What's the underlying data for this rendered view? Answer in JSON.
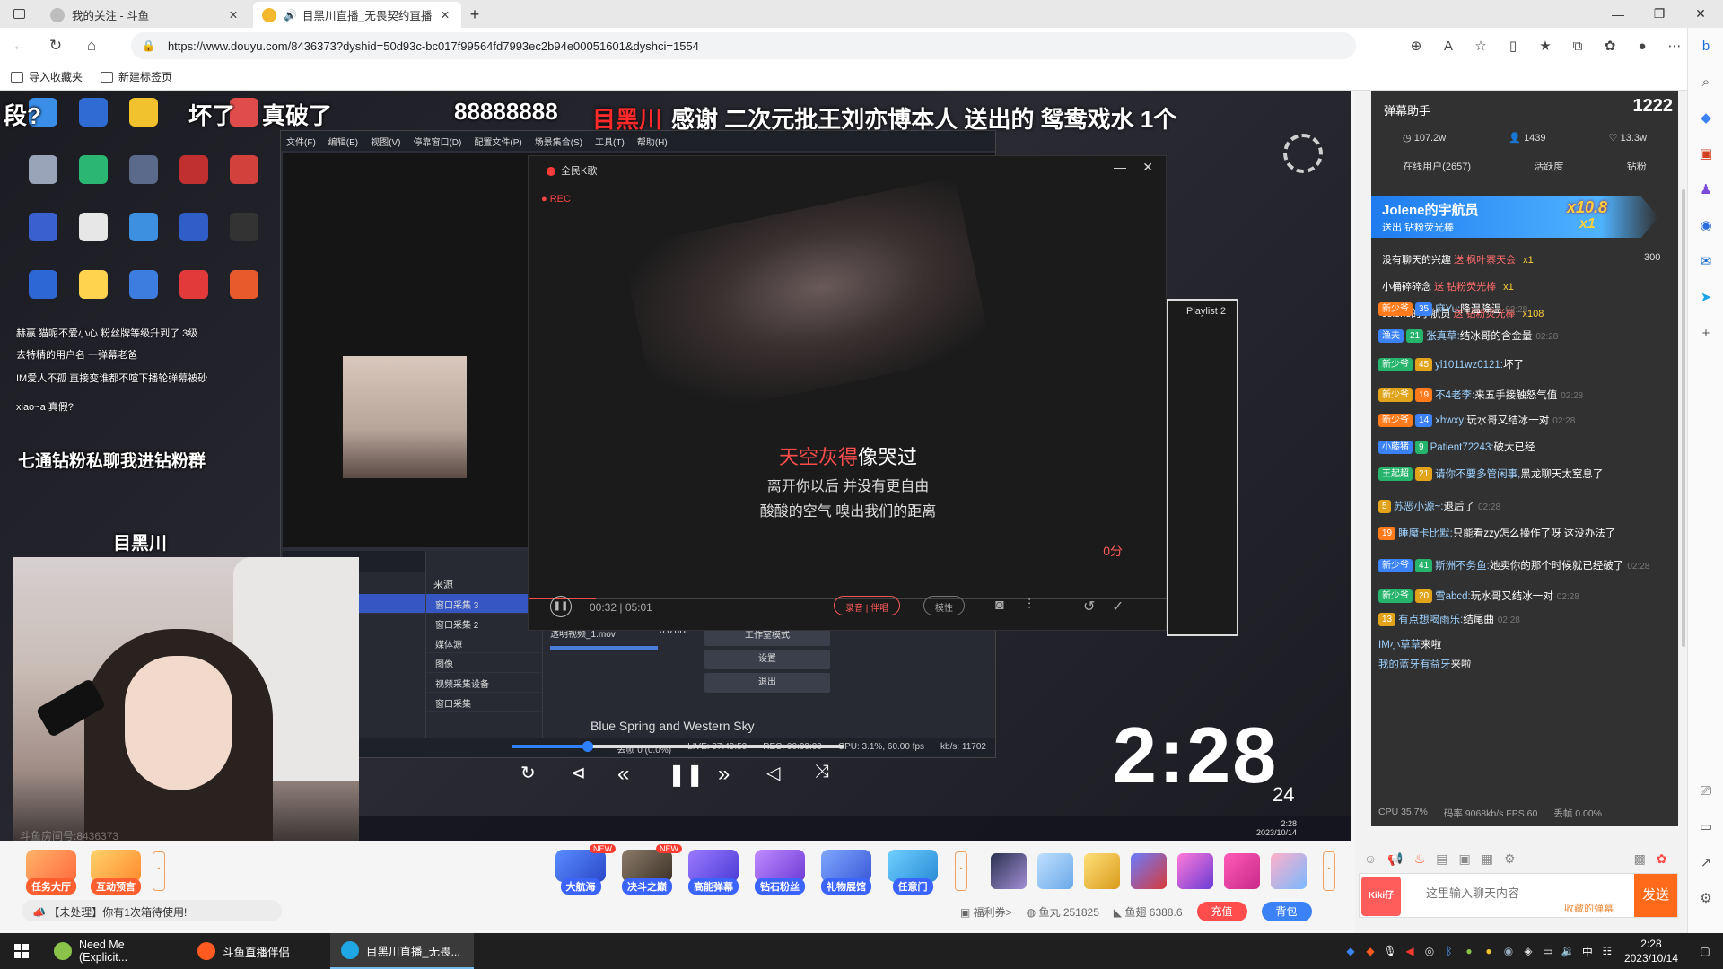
{
  "browser": {
    "tabs": [
      {
        "label": "我的关注 - 斗鱼",
        "active": false
      },
      {
        "label": "目黑川直播_无畏契约直播",
        "active": true
      }
    ],
    "url": "https://www.douyu.com/8436373?dyshid=50d93c-bc017f99564fd7993ec2b94e00051601&dyshci=1554",
    "favorites": [
      "导入收藏夹",
      "新建标签页"
    ]
  },
  "stream": {
    "danmu_top": [
      "段?",
      "坏了",
      "真破了",
      "88888888"
    ],
    "gift_banner": {
      "name": "目黑川",
      "text": "感谢 二次元批王刘亦博本人 送出的 鸳鸯戏水 1个"
    },
    "overlay_big": [
      "七通钻粉私聊我进钻粉群",
      "目黑川"
    ],
    "overlay_lines": [
      "赫赢 猫呢不爱小心 粉丝牌等级升到了 3级",
      "去特精的用户名 一弹幕老爸",
      "IM爱人不孤 直接变谁都不喧下播轮弹幕被砂",
      "xiao~a 真假?"
    ],
    "cam_watermark": "斗鱼房间号:8436373",
    "obs": {
      "menu": [
        "文件(F)",
        "编辑(E)",
        "视图(V)",
        "停靠窗口(D)",
        "配置文件(P)",
        "场景集合(S)",
        "工具(T)",
        "帮助(H)"
      ],
      "window_title": "窗口采集 3",
      "scene_header": "场景",
      "source_header": "来源",
      "sources": [
        "窗口采集 3",
        "窗口采集 2",
        "媒体源",
        "图像",
        "视频采集设备",
        "窗口采集"
      ],
      "audio_track": "透明视频_1.mov",
      "audio_level": "0.0 dB",
      "buttons": [
        "工作室模式",
        "设置",
        "退出"
      ],
      "status": [
        "丢帧 0 (0.0%)",
        "LIVE: 07:49:50",
        "REC: 00:00:00",
        "CPU: 3.1%, 60.00 fps",
        "kb/s: 11702"
      ]
    },
    "player": {
      "title": "全民K歌",
      "rec": "REC",
      "lyric_1_hl": "天空灰得",
      "lyric_1_rest": "像哭过",
      "lyric_2": "离开你以后 并没有更自由",
      "lyric_3": "酸酸的空气 嗅出我们的距离",
      "time": "00:32 | 05:01",
      "score": "0分",
      "progress": 0.105,
      "buttons": [
        "录音 | 伴唱",
        "模性"
      ]
    },
    "playlist_label": "Playlist 2",
    "now_playing": "Blue Spring and Western Sky",
    "now_playing_progress": 0.23,
    "clock": "2:28",
    "clock_seconds": "24",
    "video_taskbar_time": "2:28",
    "video_taskbar_date": "2023/10/14"
  },
  "chat": {
    "header": "弹幕助手",
    "viewer_count": "1222",
    "stats": [
      "107.2w",
      "1439",
      "13.3w"
    ],
    "tabs": [
      "在线用户(2657)",
      "活跃度",
      "钻粉"
    ],
    "gift_card": {
      "user": "Jolene的宇航员",
      "line": "送出 钻粉荧光棒",
      "combo": "x10.8",
      "count": "x1"
    },
    "gift_lines": [
      {
        "user": "没有聊天的兴趣",
        "gift": "送 枫叶寨天会",
        "qty": "x1",
        "right": "300"
      },
      {
        "user": "小桶碎碎念",
        "gift": "送 钻粉荧光棒",
        "qty": "x1",
        "right": ""
      },
      {
        "user": "Jolene的宇航员",
        "gift": "送 钻粉荧光棒",
        "qty": "x108",
        "right": ""
      }
    ],
    "messages": [
      {
        "badges": [
          "新少爷",
          "35"
        ],
        "name": "麻Yu:",
        "text": "降温降温",
        "time": "02:28"
      },
      {
        "badges": [
          "渔夫",
          "21"
        ],
        "name": "张真草:",
        "text": "结冰哥的含金量",
        "time": "02:28"
      },
      {
        "badges": [
          "新少爷",
          "45"
        ],
        "name": "yl1011wz0121:",
        "text": "坏了",
        "time": ""
      },
      {
        "badges": [
          "新少爷",
          "19"
        ],
        "name": "不4老李:",
        "text": "来五手接触怒气值",
        "time": "02:28"
      },
      {
        "badges": [
          "新少爷",
          "14"
        ],
        "name": "xhwxy:",
        "text": "玩水哥又结冰一对",
        "time": "02:28"
      },
      {
        "badges": [
          "小藤猪",
          "9"
        ],
        "name": "Patient72243:",
        "text": "破大已经",
        "time": ""
      },
      {
        "badges": [
          "王起超",
          "21"
        ],
        "name": "请你不要多管闲事,",
        "text": "黑龙聊天太窒息了",
        "time": ""
      },
      {
        "badges": [
          "5"
        ],
        "name": "苏恶小源~:",
        "text": "退后了",
        "time": "02:28"
      },
      {
        "badges": [
          "19"
        ],
        "name": "睡魔卡比默:",
        "text": "只能看zzy怎么操作了呀 这没办法了",
        "time": ""
      },
      {
        "badges": [
          "新少爷",
          "41"
        ],
        "name": "斯洲不务鱼:",
        "text": "她卖你的那个时候就已经破了",
        "time": "02:28"
      },
      {
        "badges": [
          "新少爷",
          "20"
        ],
        "name": "雪abcd:",
        "text": "玩水哥又结冰一对",
        "time": "02:28"
      },
      {
        "badges": [
          "13"
        ],
        "name": "有点想喝雨乐:",
        "text": "结尾曲",
        "time": "02:28"
      },
      {
        "badges": [],
        "name": "IM小草草",
        "text": "来啦",
        "time": ""
      },
      {
        "badges": [],
        "name": "我的蓝牙有益牙",
        "text": "来啦",
        "time": ""
      }
    ],
    "footer": [
      "CPU 35.7%",
      "码率 9068kb/s FPS 60",
      "丢帧 0.00%"
    ],
    "input_placeholder": "这里输入聊天内容",
    "input_hint": "收藏的弹幕",
    "send_label": "发送",
    "avatar_label": "Kiki仔"
  },
  "toolbar": {
    "tools": [
      {
        "label": "任务大厅",
        "color": "#ff5f2e"
      },
      {
        "label": "互动预言",
        "color": "#ff5f2e"
      }
    ],
    "features": [
      {
        "label": "大航海",
        "new": true
      },
      {
        "label": "决斗之巅",
        "new": true
      },
      {
        "label": "高能弹幕",
        "new": false
      },
      {
        "label": "钻石粉丝",
        "new": false
      },
      {
        "label": "礼物展馆",
        "new": false
      },
      {
        "label": "任意门",
        "new": false
      }
    ],
    "new_tag": "NEW",
    "notice": "【未处理】你有1次箱待使用!",
    "welfare": "福利券>",
    "fish_ball": "鱼丸 251825",
    "fish_wing": "鱼翅 6388.6",
    "recharge": "充值",
    "backpack": "背包"
  },
  "taskbar": {
    "apps": [
      {
        "label": "Need Me (Explicit...",
        "active": false,
        "color": "#8bc34a"
      },
      {
        "label": "斗鱼直播伴侣",
        "active": false,
        "color": "#ff5a1f"
      },
      {
        "label": "目黑川直播_无畏...",
        "active": true,
        "color": "#1ea7e4"
      }
    ],
    "time": "2:28",
    "date": "2023/10/14",
    "ime": "中"
  }
}
